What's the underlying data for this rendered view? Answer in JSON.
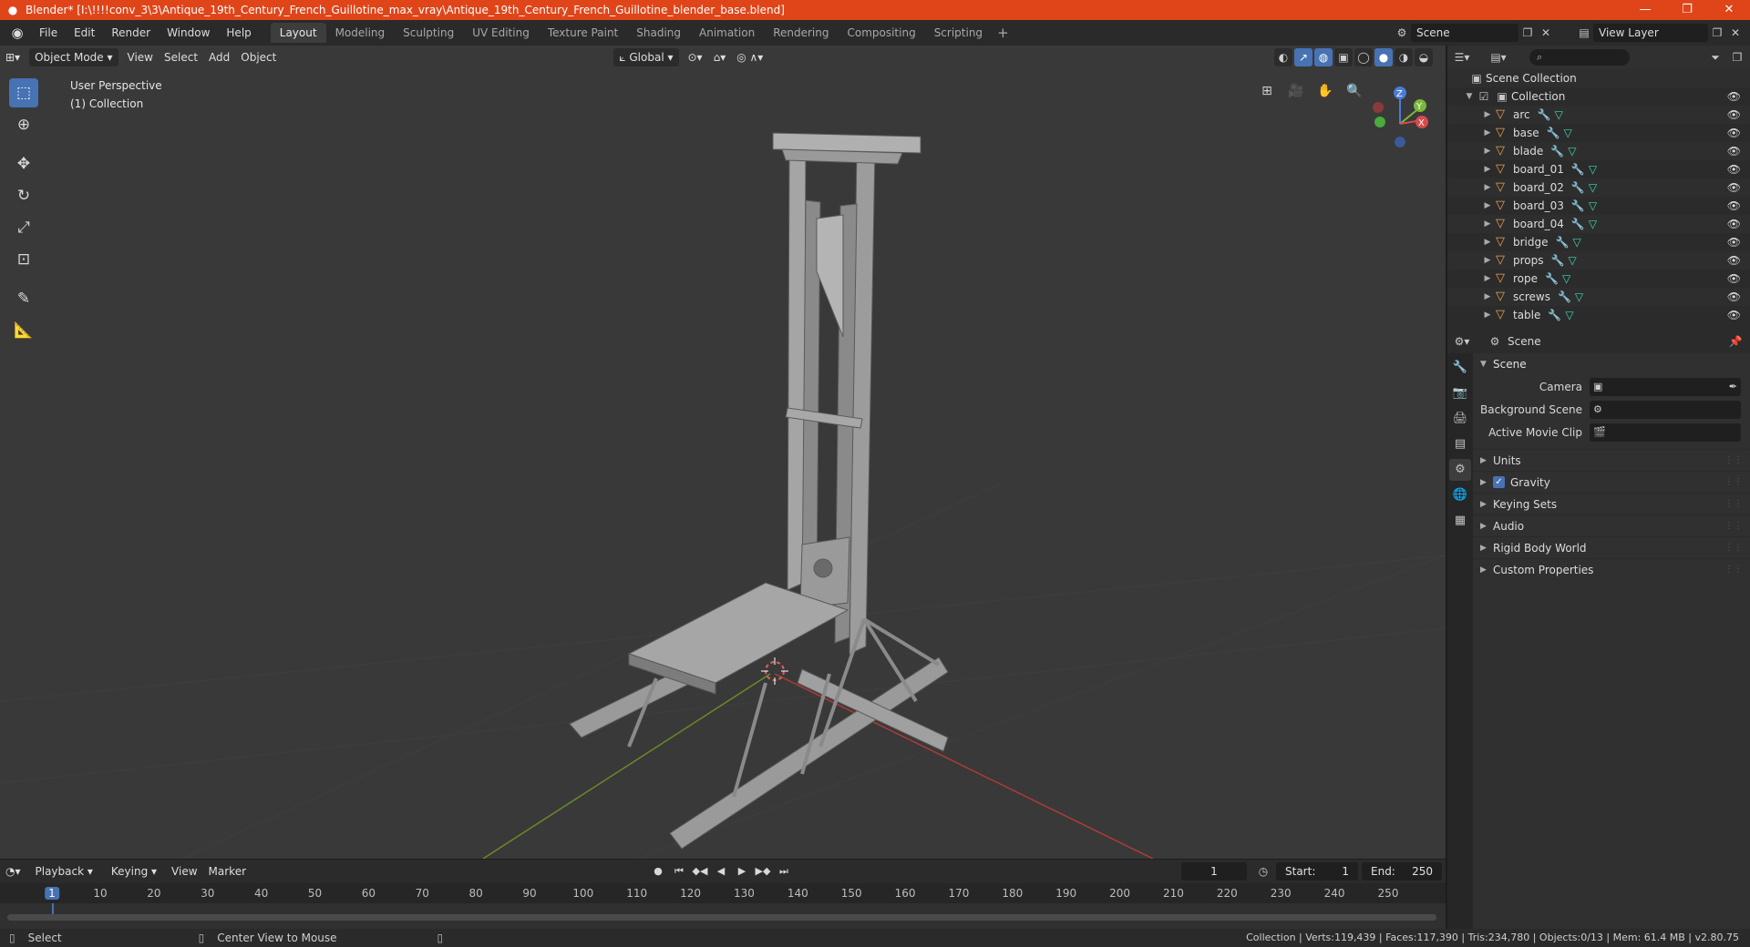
{
  "window": {
    "title": "Blender* [I:\\!!!!conv_3\\3\\Antique_19th_Century_French_Guillotine_max_vray\\Antique_19th_Century_French_Guillotine_blender_base.blend]",
    "minimize": "—",
    "maximize": "❐",
    "close": "✕"
  },
  "menu": [
    "File",
    "Edit",
    "Render",
    "Window",
    "Help"
  ],
  "workspaces": [
    {
      "label": "Layout",
      "active": true
    },
    {
      "label": "Modeling"
    },
    {
      "label": "Sculpting"
    },
    {
      "label": "UV Editing"
    },
    {
      "label": "Texture Paint"
    },
    {
      "label": "Shading"
    },
    {
      "label": "Animation"
    },
    {
      "label": "Rendering"
    },
    {
      "label": "Compositing"
    },
    {
      "label": "Scripting"
    }
  ],
  "scene_selector": "Scene",
  "view_layer_selector": "View Layer",
  "viewport": {
    "mode": "Object Mode",
    "menus": [
      "View",
      "Select",
      "Add",
      "Object"
    ],
    "transform_orientation": "Global",
    "perspective_label": "User Perspective",
    "collection_label": "(1) Collection",
    "gizmo_axes": {
      "x": "X",
      "y": "Y",
      "z": "Z"
    },
    "colors": {
      "background": "#393939",
      "x_axis": "#b03a3a",
      "y_axis": "#6a8a2a",
      "active": "#4772b3"
    }
  },
  "timeline": {
    "menus": [
      "Playback",
      "Keying",
      "View",
      "Marker"
    ],
    "current_frame": "1",
    "start_label": "Start:",
    "start_value": "1",
    "end_label": "End:",
    "end_value": "250",
    "ticks": [
      "1",
      "10",
      "20",
      "30",
      "40",
      "50",
      "60",
      "70",
      "80",
      "90",
      "100",
      "110",
      "120",
      "130",
      "140",
      "150",
      "160",
      "170",
      "180",
      "190",
      "200",
      "210",
      "220",
      "230",
      "240",
      "250"
    ]
  },
  "statusbar": {
    "select": "Select",
    "center_view": "Center View to Mouse",
    "stats": "Collection | Verts:119,439 | Faces:117,390 | Tris:234,780 | Objects:0/13 | Mem: 61.4 MB | v2.80.75"
  },
  "outliner": {
    "scene_collection": "Scene Collection",
    "collection": "Collection",
    "objects": [
      "arc",
      "base",
      "blade",
      "board_01",
      "board_02",
      "board_03",
      "board_04",
      "bridge",
      "props",
      "rope",
      "screws",
      "table"
    ]
  },
  "properties": {
    "header_title": "Scene",
    "panel_title": "Scene",
    "camera_label": "Camera",
    "background_scene_label": "Background Scene",
    "active_movie_clip_label": "Active Movie Clip",
    "subpanels": [
      "Units",
      "Gravity",
      "Keying Sets",
      "Audio",
      "Rigid Body World",
      "Custom Properties"
    ]
  }
}
